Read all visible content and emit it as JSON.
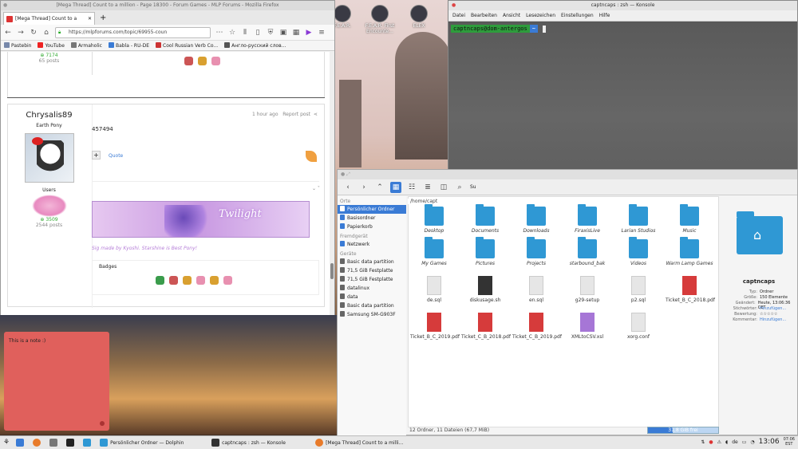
{
  "desktop": {
    "icons": [
      {
        "label": "F.E.A.R."
      },
      {
        "label": "F.E.A.R. First Encounte..."
      },
      {
        "label": "ELEX"
      }
    ],
    "note_text": "This is a note :)"
  },
  "firefox": {
    "window_title": "[Mega Thread] Count to a million - Page 18300 - Forum Games - MLP Forums - Mozilla Firefox",
    "tab_label": "[Mega Thread] Count to a",
    "url": "https://mlpforums.com/topic/69955-coun",
    "bookmarks": [
      "Pastebin",
      "YouTube",
      "Armaholic",
      "Babla - RU-DE",
      "Cool Russian Verb Co...",
      "Англо-русский слов..."
    ],
    "prev_post": {
      "points": "7174",
      "posts": "65 posts"
    },
    "post": {
      "author": "Chrysalis89",
      "rank": "Earth Pony",
      "group": "Users",
      "points": "3509",
      "posts": "2544 posts",
      "time": "1 hour ago",
      "report": "Report post",
      "number": "457494",
      "quote_label": "Quote",
      "sig_word": "Twilight",
      "sig_text": "Sig made by Kyoshi. Starshine is Best Pony!",
      "badges_label": "Badges"
    }
  },
  "konsole": {
    "window_title": "captncaps : zsh — Konsole",
    "menu": [
      "Datei",
      "Bearbeiten",
      "Ansicht",
      "Lesezeichen",
      "Einstellungen",
      "Hilfe"
    ],
    "prompt_user": "captncaps@dom-antergos",
    "prompt_dir": "~"
  },
  "dolphin": {
    "search_label": "Su",
    "path": "/home/capt",
    "sidebar": [
      {
        "header": "Orte"
      },
      {
        "label": "Persönlicher Ordner",
        "selected": true
      },
      {
        "label": "Basisordner"
      },
      {
        "label": "Papierkorb"
      },
      {
        "header": "Fremdgerät"
      },
      {
        "label": "Netzwerk"
      },
      {
        "header": "Geräte"
      },
      {
        "label": "Basic data partition",
        "device": true
      },
      {
        "label": "71,5 GiB Festplatte",
        "device": true
      },
      {
        "label": "71,5 GiB Festplatte",
        "device": true
      },
      {
        "label": "datalinux",
        "device": true
      },
      {
        "label": "data",
        "device": true
      },
      {
        "label": "Basic data partition",
        "device": true
      },
      {
        "label": "Samsung SM-G903F",
        "device": true
      }
    ],
    "files": [
      {
        "name": "Desktop",
        "kind": "folder"
      },
      {
        "name": "Documents",
        "kind": "folder"
      },
      {
        "name": "Downloads",
        "kind": "folder"
      },
      {
        "name": "FiraxisLive",
        "kind": "folder"
      },
      {
        "name": "Larian Studios",
        "kind": "folder"
      },
      {
        "name": "Music",
        "kind": "folder"
      },
      {
        "name": "My Games",
        "kind": "folder"
      },
      {
        "name": "Pictures",
        "kind": "folder"
      },
      {
        "name": "Projects",
        "kind": "folder"
      },
      {
        "name": "starbound_bak",
        "kind": "folder"
      },
      {
        "name": "Videos",
        "kind": "folder"
      },
      {
        "name": "Warm Lamp Games",
        "kind": "folder"
      },
      {
        "name": "de.sql",
        "kind": "doc"
      },
      {
        "name": "diskusage.sh",
        "kind": "sh"
      },
      {
        "name": "en.sql",
        "kind": "doc"
      },
      {
        "name": "g29-setup",
        "kind": "doc"
      },
      {
        "name": "p2.sql",
        "kind": "doc"
      },
      {
        "name": "Ticket_B_C_2018.pdf",
        "kind": "pdf"
      },
      {
        "name": "Ticket_B_C_2019.pdf",
        "kind": "pdf"
      },
      {
        "name": "Ticket_C_B_2018.pdf",
        "kind": "pdf"
      },
      {
        "name": "Ticket_C_B_2019.pdf",
        "kind": "pdf"
      },
      {
        "name": "XMLtoCSV.xsl",
        "kind": "xsl"
      },
      {
        "name": "xorg.conf",
        "kind": "doc"
      }
    ],
    "status": "12 Ordner, 11 Dateien (67,7 MiB)",
    "free_space": "31,8 GiB frei",
    "free_fraction": 0.35,
    "info": {
      "name": "captncaps",
      "rows": [
        {
          "k": "Typ:",
          "v": "Ordner"
        },
        {
          "k": "Größe:",
          "v": "150 Elemente"
        },
        {
          "k": "Geändert:",
          "v": "Heute, 13:06:36 CET"
        },
        {
          "k": "Stichwörter:",
          "v": "Hinzufügen..."
        },
        {
          "k": "Bewertung:",
          "v": "☆☆☆☆☆"
        },
        {
          "k": "Kommentar:",
          "v": "Hinzufügen..."
        }
      ]
    }
  },
  "taskbar": {
    "tasks": [
      "Persönlicher Ordner — Dolphin",
      "captncaps : zsh — Konsole",
      "[Mega Thread] Count to a milli..."
    ],
    "lang": "de",
    "time": "13:06",
    "time2": "07:06",
    "tz2": "EST"
  }
}
